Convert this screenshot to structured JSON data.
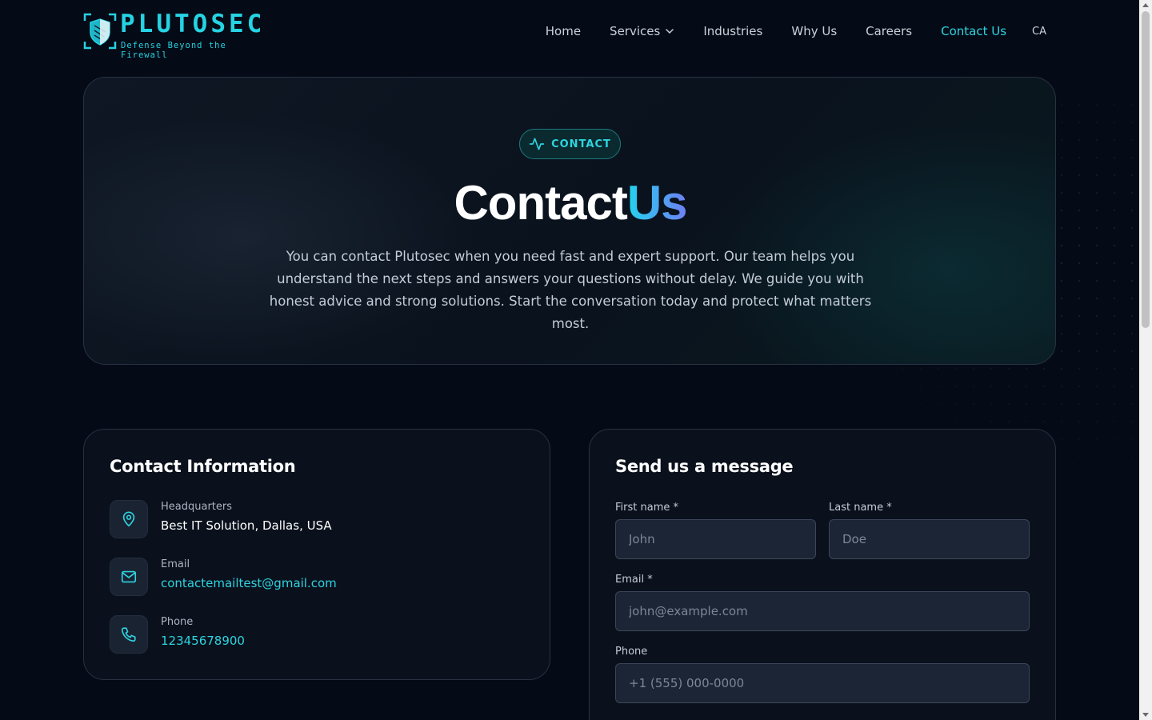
{
  "header": {
    "logo": {
      "name": "PLUTOSEC",
      "tagline": "Defense Beyond the Firewall"
    },
    "nav": [
      {
        "label": "Home",
        "active": false
      },
      {
        "label": "Services",
        "active": false,
        "dropdown": true
      },
      {
        "label": "Industries",
        "active": false
      },
      {
        "label": "Why Us",
        "active": false
      },
      {
        "label": "Careers",
        "active": false
      },
      {
        "label": "Contact Us",
        "active": true
      }
    ],
    "language": "CA"
  },
  "hero": {
    "badge": "CONTACT",
    "badge_icon": "activity-pulse-icon",
    "title_main": "Contact",
    "title_accent": "Us",
    "description": "You can contact Plutosec when you need fast and expert support. Our team helps you understand the next steps and answers your questions without delay. We guide you with honest advice and strong solutions. Start the conversation today and protect what matters most."
  },
  "contact_info": {
    "title": "Contact Information",
    "items": [
      {
        "icon": "map-pin-icon",
        "label": "Headquarters",
        "value": "Best IT Solution, Dallas, USA",
        "link": false
      },
      {
        "icon": "mail-icon",
        "label": "Email",
        "value": "contactemailtest@gmail.com",
        "link": true
      },
      {
        "icon": "phone-icon",
        "label": "Phone",
        "value": "12345678900",
        "link": true
      }
    ]
  },
  "form": {
    "title": "Send us a message",
    "first_name": {
      "label": "First name *",
      "placeholder": "John",
      "value": ""
    },
    "last_name": {
      "label": "Last name *",
      "placeholder": "Doe",
      "value": ""
    },
    "email": {
      "label": "Email *",
      "placeholder": "john@example.com",
      "value": ""
    },
    "phone": {
      "label": "Phone",
      "placeholder": "+1 (555) 000-0000",
      "value": ""
    }
  },
  "colors": {
    "background": "#050b16",
    "accent": "#2ed3e0",
    "accent_gradient_end": "#6f7ff5",
    "card": "#0a111c",
    "input": "#1b2535"
  }
}
